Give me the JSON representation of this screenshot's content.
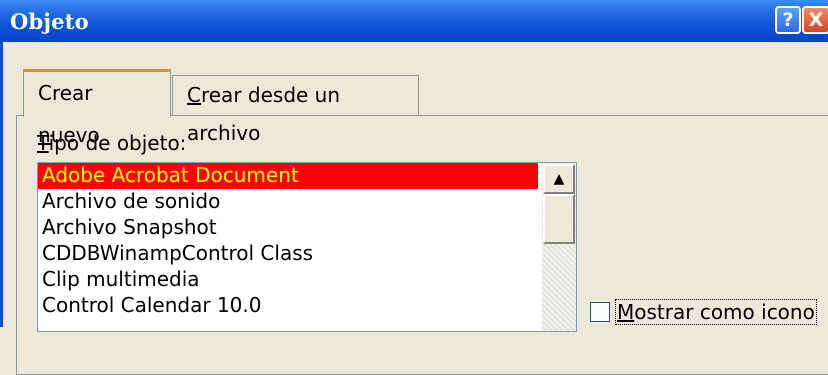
{
  "window": {
    "title": "Objeto",
    "help_glyph": "?",
    "close_glyph": "X"
  },
  "tabs": [
    {
      "label_pre": "Crear ",
      "label_ul": "n",
      "label_post": "uevo",
      "active": true
    },
    {
      "label_pre": "",
      "label_ul": "C",
      "label_post": "rear desde un archivo",
      "active": false
    }
  ],
  "object_type": {
    "label_ul": "T",
    "label_post": "ipo de objeto:",
    "items": [
      "Adobe Acrobat Document",
      "Archivo de sonido",
      "Archivo Snapshot",
      "CDDBWinampControl Class",
      "Clip multimedia",
      "Control Calendar 10.0"
    ],
    "selected_index": 0,
    "scroll_up_glyph": "▲"
  },
  "display_as_icon": {
    "label_ul": "M",
    "label_post": "ostrar como icono",
    "checked": false
  },
  "colors": {
    "selection_bg": "#ff0000",
    "selection_fg": "#ffff00",
    "titlebar": "#0a4fd6",
    "dialog_bg": "#ece9d8"
  }
}
